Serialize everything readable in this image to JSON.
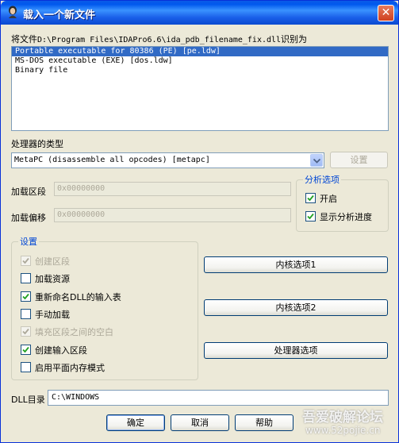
{
  "window": {
    "title": "载入一个新文件",
    "close_label": "✕",
    "icon": "ida-icon"
  },
  "file_prompt": {
    "prefix": "将文件",
    "path": "D:\\Program Files\\IDAPro6.6\\ida_pdb_filename_fix.dll",
    "suffix": "识别为"
  },
  "file_types": [
    {
      "label": "Portable executable for 80386 (PE) [pe.ldw]",
      "selected": true
    },
    {
      "label": "MS-DOS executable (EXE) [dos.ldw]",
      "selected": false
    },
    {
      "label": "Binary file",
      "selected": false
    }
  ],
  "processor": {
    "label": "处理器的类型",
    "value": "MetaPC (disassemble all opcodes) [metapc]",
    "settings_button": "设置"
  },
  "loading": {
    "segment_label": "加载区段",
    "segment_value": "0x00000000",
    "offset_label": "加载偏移",
    "offset_value": "0x00000000"
  },
  "analysis": {
    "title": "分析选项",
    "options": [
      {
        "label": "开启",
        "checked": true
      },
      {
        "label": "显示分析进度",
        "checked": true
      }
    ]
  },
  "settings": {
    "title": "设置",
    "options": [
      {
        "label": "创建区段",
        "checked": true,
        "disabled": true
      },
      {
        "label": "加载资源",
        "checked": false,
        "disabled": false
      },
      {
        "label": "重新命名DLL的输入表",
        "checked": true,
        "disabled": false
      },
      {
        "label": "手动加载",
        "checked": false,
        "disabled": false
      },
      {
        "label": "填充区段之间的空白",
        "checked": true,
        "disabled": true
      },
      {
        "label": "创建输入区段",
        "checked": true,
        "disabled": false
      },
      {
        "label": "启用平面内存模式",
        "checked": false,
        "disabled": false
      }
    ]
  },
  "side_buttons": {
    "kernel1": "内核选项1",
    "kernel2": "内核选项2",
    "processor": "处理器选项"
  },
  "dll_dir": {
    "label": "DLL目录",
    "value": "C:\\WINDOWS"
  },
  "dialog_buttons": {
    "ok": "确定",
    "cancel": "取消",
    "help": "帮助"
  },
  "watermark": {
    "line1": "吾爱破解论坛",
    "line2": "www.52pojie.cn"
  },
  "colors": {
    "titlebar": "#0058ee",
    "selection": "#316ac5",
    "group_title": "#0046d5",
    "dialog_bg": "#ece9d8"
  }
}
